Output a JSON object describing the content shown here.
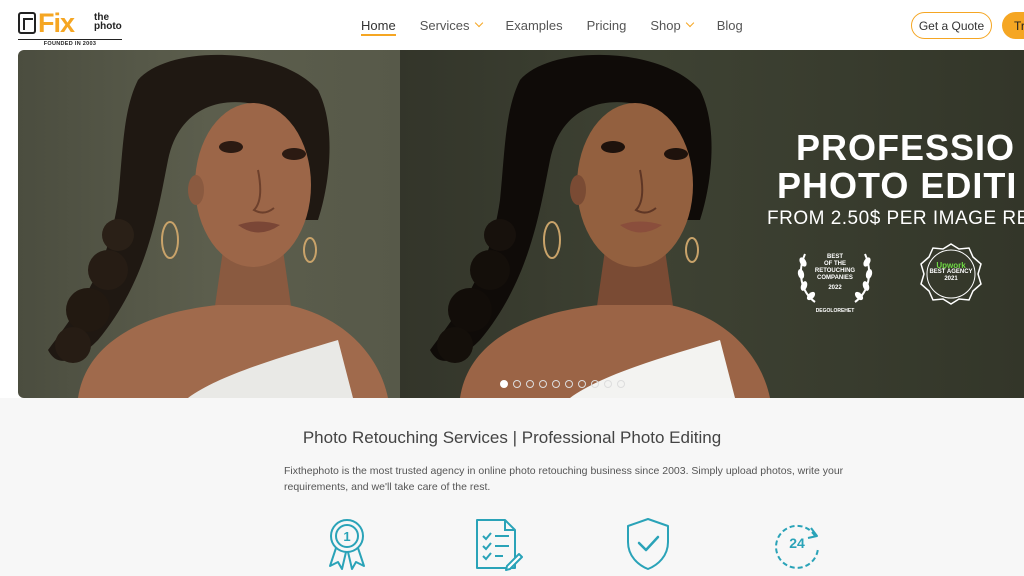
{
  "logo": {
    "fix": "Fix",
    "the": "the",
    "photo": "photo",
    "founded": "FOUNDED IN 2003"
  },
  "nav": {
    "items": [
      {
        "label": "Home",
        "active": true,
        "dropdown": false
      },
      {
        "label": "Services",
        "active": false,
        "dropdown": true
      },
      {
        "label": "Examples",
        "active": false,
        "dropdown": false
      },
      {
        "label": "Pricing",
        "active": false,
        "dropdown": false
      },
      {
        "label": "Shop",
        "active": false,
        "dropdown": true
      },
      {
        "label": "Blog",
        "active": false,
        "dropdown": false
      }
    ],
    "quote_label": "Get a Quote",
    "try_label": "Tr"
  },
  "hero": {
    "title_line1": "PROFESSIO",
    "title_line2": "PHOTO EDITI",
    "subtitle": "FROM 2.50$ PER IMAGE RE",
    "award1": {
      "line1": "BEST",
      "line2": "OF THE",
      "line3": "RETOUCHING",
      "line4": "COMPANIES",
      "year": "2022",
      "source": "DEGOLOREНЕТ"
    },
    "award2": {
      "brand": "Upwork",
      "line": "BEST AGENCY",
      "year": "2021"
    },
    "slide_count": 10,
    "active_slide": 0
  },
  "main": {
    "title": "Photo Retouching Services | Professional Photo Editing",
    "description": "Fixthephoto is the most trusted agency in online photo retouching business since 2003. Simply upload photos, write your requirements, and we'll take care of the rest.",
    "features": [
      {
        "icon": "award-ribbon-icon"
      },
      {
        "icon": "checklist-document-icon"
      },
      {
        "icon": "shield-check-icon"
      },
      {
        "icon": "clock-24-icon"
      }
    ]
  },
  "colors": {
    "accent": "#f5a623",
    "teal": "#2aa3b8",
    "hero_bg_left": "#575949",
    "hero_bg_right": "#3a3d30"
  }
}
